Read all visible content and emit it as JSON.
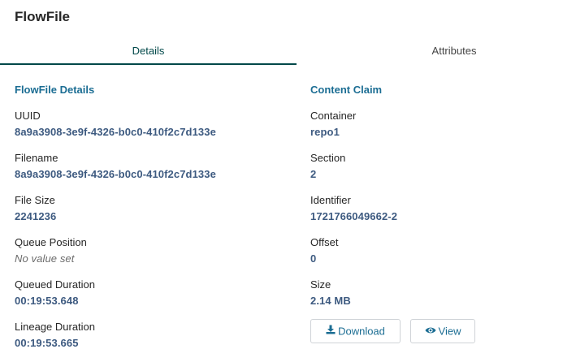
{
  "dialog": {
    "title": "FlowFile",
    "tabs": [
      {
        "label": "Details",
        "active": true
      },
      {
        "label": "Attributes",
        "active": false
      }
    ]
  },
  "details": {
    "section_title": "FlowFile Details",
    "fields": [
      {
        "label": "UUID",
        "value": "8a9a3908-3e9f-4326-b0c0-410f2c7d133e"
      },
      {
        "label": "Filename",
        "value": "8a9a3908-3e9f-4326-b0c0-410f2c7d133e"
      },
      {
        "label": "File Size",
        "value": "2241236"
      },
      {
        "label": "Queue Position",
        "value": "No value set"
      },
      {
        "label": "Queued Duration",
        "value": "00:19:53.648"
      },
      {
        "label": "Lineage Duration",
        "value": "00:19:53.665"
      }
    ]
  },
  "content_claim": {
    "section_title": "Content Claim",
    "fields": [
      {
        "label": "Container",
        "value": "repo1"
      },
      {
        "label": "Section",
        "value": "2"
      },
      {
        "label": "Identifier",
        "value": "1721766049662-2"
      },
      {
        "label": "Offset",
        "value": "0"
      },
      {
        "label": "Size",
        "value": "2.14 MB"
      }
    ],
    "download_label": "Download",
    "view_label": "View",
    "download_icon": "download-icon",
    "view_icon": "eye-icon"
  },
  "colors": {
    "accent": "#1b6d93",
    "value_text": "#3d5a80",
    "active_tab_underline": "#004849"
  }
}
